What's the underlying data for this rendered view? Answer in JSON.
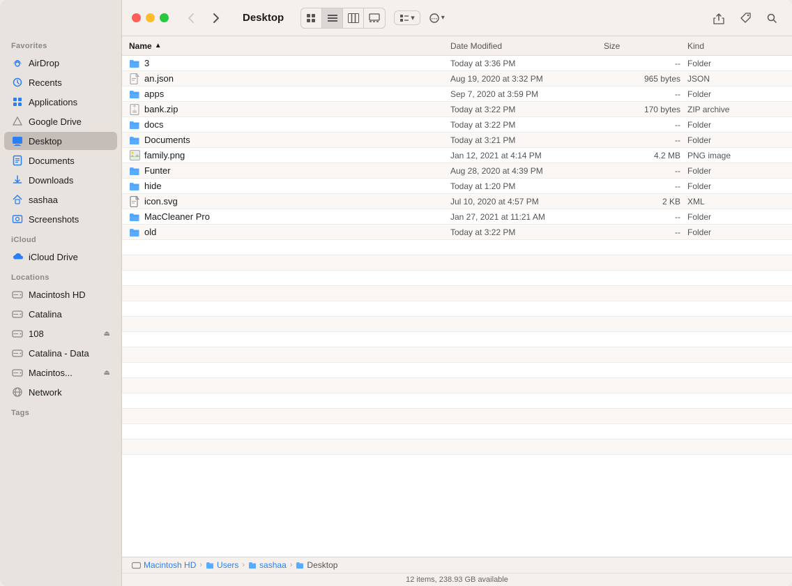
{
  "window": {
    "title": "Desktop"
  },
  "toolbar": {
    "back_disabled": true,
    "forward_disabled": false,
    "views": [
      "grid-view",
      "list-view",
      "column-view",
      "gallery-view"
    ],
    "active_view": "list-view",
    "group_label": "Group",
    "share_label": "Share",
    "tag_label": "Tag",
    "search_label": "Search"
  },
  "columns": {
    "name": "Name",
    "date_modified": "Date Modified",
    "size": "Size",
    "kind": "Kind"
  },
  "files": [
    {
      "name": "3",
      "type": "folder",
      "date": "Today at 3:36 PM",
      "size": "--",
      "kind": "Folder",
      "selected": false
    },
    {
      "name": "an.json",
      "type": "file",
      "icon": "json",
      "date": "Aug 19, 2020 at 3:32 PM",
      "size": "965 bytes",
      "kind": "JSON",
      "selected": false
    },
    {
      "name": "apps",
      "type": "folder",
      "date": "Sep 7, 2020 at 3:59 PM",
      "size": "--",
      "kind": "Folder",
      "selected": false
    },
    {
      "name": "bank.zip",
      "type": "file",
      "icon": "zip",
      "date": "Today at 3:22 PM",
      "size": "170 bytes",
      "kind": "ZIP archive",
      "selected": false
    },
    {
      "name": "docs",
      "type": "folder",
      "date": "Today at 3:22 PM",
      "size": "--",
      "kind": "Folder",
      "selected": false
    },
    {
      "name": "Documents",
      "type": "folder",
      "date": "Today at 3:21 PM",
      "size": "--",
      "kind": "Folder",
      "selected": false
    },
    {
      "name": "family.png",
      "type": "file",
      "icon": "img",
      "date": "Jan 12, 2021 at 4:14 PM",
      "size": "4.2 MB",
      "kind": "PNG image",
      "selected": false
    },
    {
      "name": "Funter",
      "type": "folder",
      "date": "Aug 28, 2020 at 4:39 PM",
      "size": "--",
      "kind": "Folder",
      "selected": true
    },
    {
      "name": "hide",
      "type": "folder",
      "date": "Today at 1:20 PM",
      "size": "--",
      "kind": "Folder",
      "selected": false
    },
    {
      "name": "icon.svg",
      "type": "file",
      "icon": "svg",
      "date": "Jul 10, 2020 at 4:57 PM",
      "size": "2 KB",
      "kind": "XML",
      "selected": false
    },
    {
      "name": "MacCleaner Pro",
      "type": "folder",
      "date": "Jan 27, 2021 at 11:21 AM",
      "size": "--",
      "kind": "Folder",
      "selected": false
    },
    {
      "name": "old",
      "type": "folder",
      "date": "Today at 3:22 PM",
      "size": "--",
      "kind": "Folder",
      "selected": false
    }
  ],
  "sidebar": {
    "favorites_label": "Favorites",
    "icloud_label": "iCloud",
    "locations_label": "Locations",
    "tags_label": "Tags",
    "favorites": [
      {
        "id": "airdrop",
        "label": "AirDrop",
        "icon": "airdrop"
      },
      {
        "id": "recents",
        "label": "Recents",
        "icon": "clock"
      },
      {
        "id": "applications",
        "label": "Applications",
        "icon": "apps"
      },
      {
        "id": "google-drive",
        "label": "Google Drive",
        "icon": "drive"
      },
      {
        "id": "desktop",
        "label": "Desktop",
        "icon": "desktop",
        "active": true
      },
      {
        "id": "documents",
        "label": "Documents",
        "icon": "doc"
      },
      {
        "id": "downloads",
        "label": "Downloads",
        "icon": "download"
      },
      {
        "id": "sashaa",
        "label": "sashaa",
        "icon": "home"
      },
      {
        "id": "screenshots",
        "label": "Screenshots",
        "icon": "screenshots"
      }
    ],
    "icloud": [
      {
        "id": "icloud-drive",
        "label": "iCloud Drive",
        "icon": "icloud"
      }
    ],
    "locations": [
      {
        "id": "macintosh-hd",
        "label": "Macintosh HD",
        "icon": "disk"
      },
      {
        "id": "catalina",
        "label": "Catalina",
        "icon": "disk"
      },
      {
        "id": "108",
        "label": "108",
        "icon": "disk",
        "eject": true
      },
      {
        "id": "catalina-data",
        "label": "Catalina - Data",
        "icon": "disk"
      },
      {
        "id": "macintos",
        "label": "Macintos...",
        "icon": "disk",
        "eject": true
      },
      {
        "id": "network",
        "label": "Network",
        "icon": "network"
      }
    ]
  },
  "breadcrumb": [
    {
      "label": "Macintosh HD",
      "icon": "disk"
    },
    {
      "label": "Users",
      "icon": "folder"
    },
    {
      "label": "sashaa",
      "icon": "folder"
    },
    {
      "label": "Desktop",
      "icon": "folder"
    }
  ],
  "status": {
    "items_count": "12 items, 238.93 GB available"
  }
}
